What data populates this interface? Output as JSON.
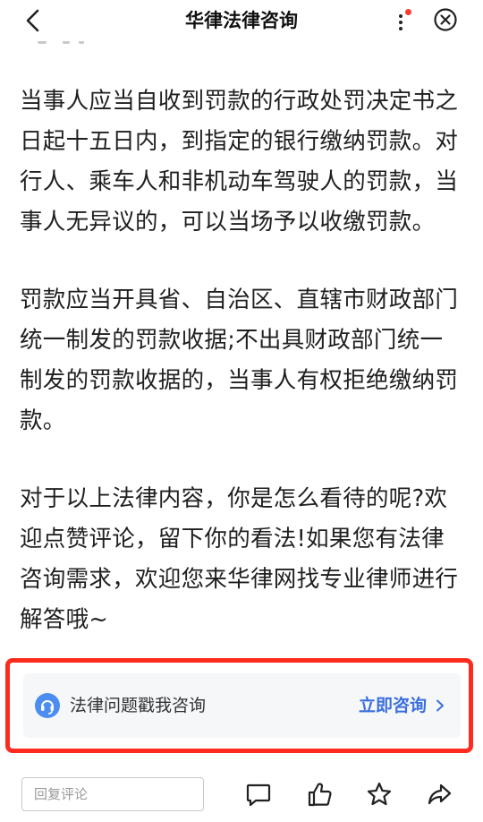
{
  "nav": {
    "title": "华律法律咨询"
  },
  "article": {
    "paragraphs": [
      "当事人应当自收到罚款的行政处罚决定书之日起十五日内，到指定的银行缴纳罚款。对行人、乘车人和非机动车驾驶人的罚款，当事人无异议的，可以当场予以收缴罚款。",
      "罚款应当开具省、自治区、直辖市财政部门统一制发的罚款收据;不出具财政部门统一制发的罚款收据的，当事人有权拒绝缴纳罚款。",
      "对于以上法律内容，你是怎么看待的呢?欢迎点赞评论，留下你的看法!如果您有法律咨询需求，欢迎您来华律网找专业律师进行解答哦~"
    ]
  },
  "consult": {
    "label": "法律问题戳我咨询",
    "action_label": "立即咨询",
    "icon": "headset-icon",
    "accent_color": "#3a6fdc",
    "highlight_color": "#ff2a1e"
  },
  "bottom_bar": {
    "comment_placeholder": "回复评论",
    "icons": [
      "comment-icon",
      "like-icon",
      "star-icon",
      "share-icon"
    ]
  }
}
